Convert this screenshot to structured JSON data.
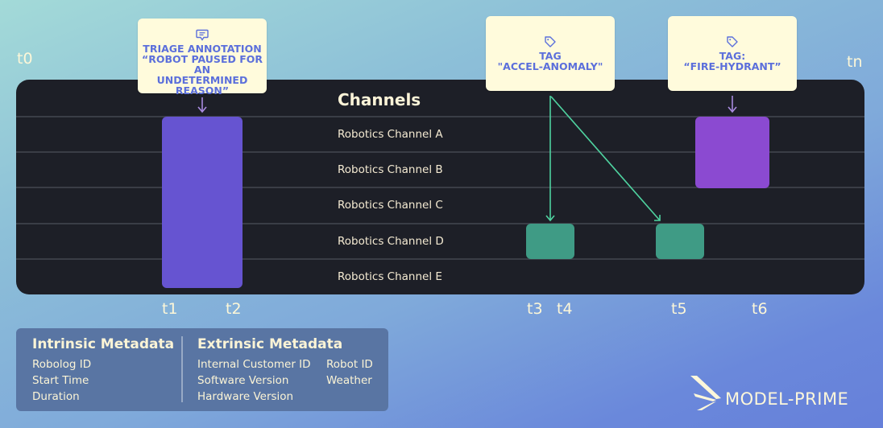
{
  "colors": {
    "panel_bg": "#1d1f27",
    "callout_bg": "#fffbdc",
    "callout_text": "#5b6fdb",
    "bar_triage": "#6654d1",
    "bar_fire_hydrant": "#8b4ad1",
    "bar_accel": "#3f9b85",
    "arrow_green": "#4fd3a0",
    "arrow_purple": "#a98be0",
    "text_cream": "#fcf4d8"
  },
  "timeline": {
    "start_label": "t0",
    "end_label": "tn",
    "ticks": [
      "t1",
      "t2",
      "t3",
      "t4",
      "t5",
      "t6"
    ]
  },
  "panel": {
    "title": "Channels",
    "channels": [
      "Robotics Channel A",
      "Robotics Channel B",
      "Robotics Channel C",
      "Robotics Channel D",
      "Robotics Channel E"
    ]
  },
  "callouts": {
    "triage": {
      "icon": "comment-icon",
      "line1": "TRIAGE ANNOTATION",
      "line2": "“ROBOT PAUSED FOR AN",
      "line3": "UNDETERMINED",
      "line4": "REASON”"
    },
    "accel": {
      "icon": "tag-icon",
      "line1": "TAG",
      "line2": "\"ACCEL-ANOMALY\""
    },
    "hydrant": {
      "icon": "tag-icon",
      "line1": "TAG:",
      "line2": "“FIRE-HYDRANT”"
    }
  },
  "events": [
    {
      "name": "triage-annotation",
      "start": "t1",
      "end": "t2",
      "channels": [
        "A",
        "B",
        "C",
        "D",
        "E"
      ]
    },
    {
      "name": "accel-anomaly-1",
      "start": "t3",
      "end": "t4",
      "channels": [
        "D"
      ]
    },
    {
      "name": "accel-anomaly-2",
      "start": "t5",
      "end": "t5",
      "channels": [
        "D"
      ]
    },
    {
      "name": "fire-hydrant",
      "start": "t6",
      "end": "t6",
      "channels": [
        "A",
        "B"
      ]
    }
  ],
  "metadata": {
    "intrinsic": {
      "title": "Intrinsic Metadata",
      "items": [
        "Robolog ID",
        "Start Time",
        "Duration"
      ]
    },
    "extrinsic": {
      "title": "Extrinsic Metadata",
      "col1": [
        "Internal Customer ID",
        "Software Version",
        "Hardware Version"
      ],
      "col2": [
        "Robot ID",
        "Weather"
      ]
    }
  },
  "brand": {
    "name": "MODEL-PRIME",
    "icon": "wing-logo-icon"
  }
}
